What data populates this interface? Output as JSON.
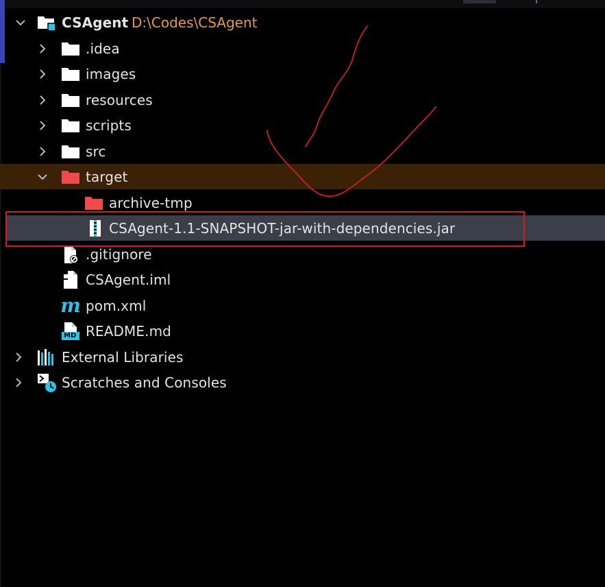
{
  "project": {
    "name": "CSAgent",
    "path": "D:\\Codes\\CSAgent"
  },
  "tree": {
    "idea": ".idea",
    "images": "images",
    "resources": "resources",
    "scripts": "scripts",
    "src": "src",
    "target": "target",
    "archive_tmp": "archive-tmp",
    "jar": "CSAgent-1.1-SNAPSHOT-jar-with-dependencies.jar",
    "gitignore": ".gitignore",
    "iml": "CSAgent.iml",
    "pom": "pom.xml",
    "readme": "README.md",
    "external_libraries": "External Libraries",
    "scratches": "Scratches and Consoles"
  },
  "icons": {
    "md_badge": "MD",
    "maven_glyph": "m"
  },
  "colors": {
    "background": "#000000",
    "text": "#e4e4e4",
    "path": "#e19a4c",
    "folder": "#ffffff",
    "excluded_folder": "#f04a4a",
    "accent_cyan": "#2bc3e8",
    "target_row": "#3b2207",
    "selected_row": "#3c3e4a",
    "annotation_red": "#d01f1f"
  }
}
